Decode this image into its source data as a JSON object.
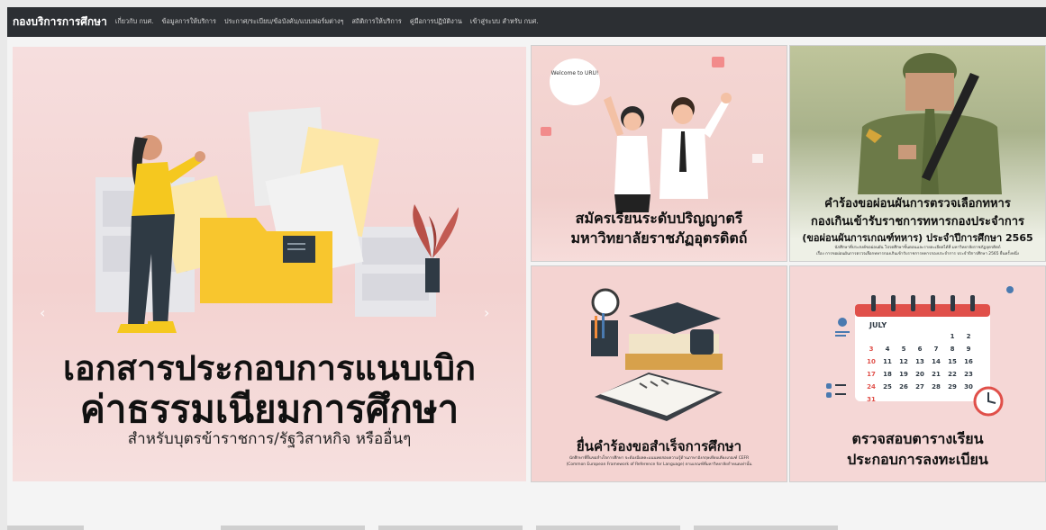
{
  "nav": {
    "brand": "กองบริการการศึกษา",
    "items": [
      "เกี่ยวกับ กบศ.",
      "ข้อมูลการให้บริการ",
      "ประกาศ/ระเบียบ/ข้อบังคับ/แบบฟอร์มต่างๆ",
      "สถิติการให้บริการ",
      "คู่มือการปฏิบัติงาน",
      "เข้าสู่ระบบ สำหรับ กบศ."
    ]
  },
  "slider": {
    "title_line1": "เอกสารประกอบการแนบเบิก",
    "title_line2": "ค่าธรรมเนียมการศึกษา",
    "subtitle": "สำหรับบุตรข้าราชการ/รัฐวิสาหกิจ หรืออื่นๆ",
    "prev": "‹",
    "next": "›"
  },
  "tiles": {
    "register": {
      "bubble": "Welcome to URU!",
      "line1": "สมัครเรียนระดับปริญญาตรี",
      "line2": "มหาวิทยาลัยราชภัฏอุตรดิตถ์"
    },
    "military": {
      "line1": "คำร้องขอผ่อนผันการตรวจเลือกทหาร",
      "line2": "กองเกินเข้ารับราชการทหารกองประจำการ",
      "line3": "(ขอผ่อนผันการเกณฑ์ทหาร) ประจำปีการศึกษา 2565",
      "small1": "นักศึกษาที่ประสงค์ขอผ่อนผัน โปรดศึกษาขั้นตอนและรายละเอียดได้ที่ มหาวิทยาลัยราชภัฏอุตรดิตถ์",
      "small2": "เรื่อง การขอผ่อนผันการตรวจเลือกทหารกองเกินเข้ารับราชการทหารกองประจำการ ประจำปีการศึกษา 2565 ยื่นครั้งหนึ่ง"
    },
    "graduate": {
      "line1": "ยื่นคำร้องขอสำเร็จการศึกษา",
      "small1": "นักศึกษาที่ยื่นขอสำเร็จการศึกษา จะต้องมีผลคะแนนทดสอบความรู้ด้านภาษาอังกฤษเทียบเคียงเกณฑ์ CEFR",
      "small2": "(Common European Framework of Reference for Language) ตามเกณฑ์ที่มหาวิทยาลัยกำหนดเท่านั้น"
    },
    "schedule": {
      "month": "JULY",
      "line1": "ตรวจสอบตารางเรียน",
      "line2": "ประกอบการลงทะเบียน",
      "calendar": [
        "1",
        "2",
        "3",
        "4",
        "5",
        "6",
        "7",
        "8",
        "9",
        "10",
        "11",
        "12",
        "13",
        "14",
        "15",
        "16",
        "17",
        "18",
        "19",
        "20",
        "21",
        "22",
        "23",
        "24",
        "25",
        "26",
        "27",
        "28",
        "29",
        "30",
        "31"
      ]
    }
  },
  "colors": {
    "navbar": "#2c2f33",
    "tile_pink": "#f4d3d1",
    "accent_red": "#e0504a",
    "folder_yellow": "#f8c62e"
  }
}
